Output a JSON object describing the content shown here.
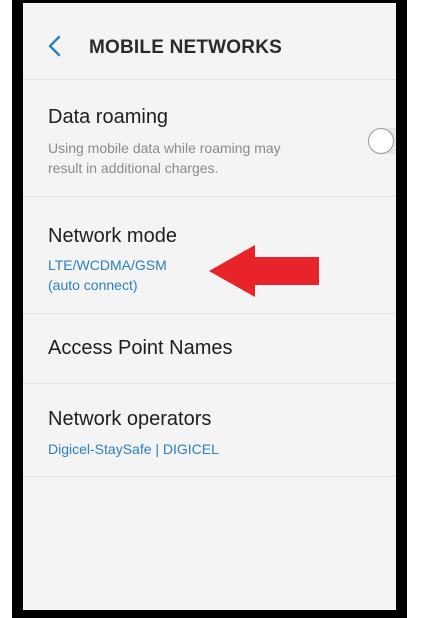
{
  "header": {
    "title": "MOBILE NETWORKS",
    "back_icon": "chevron-left-icon"
  },
  "data_roaming": {
    "title": "Data roaming",
    "description_line1": "Using mobile data while roaming may",
    "description_line2": "result in additional charges.",
    "toggle_on": false
  },
  "network_mode": {
    "title": "Network mode",
    "value_line1": "LTE/WCDMA/GSM",
    "value_line2": "(auto connect)"
  },
  "access_point_names": {
    "title": "Access Point Names"
  },
  "network_operators": {
    "title": "Network operators",
    "value": "Digicel-StaySafe | DIGICEL"
  },
  "annotation": {
    "arrow_icon": "red-arrow-left-icon",
    "arrow_color": "#e8232a"
  },
  "colors": {
    "accent": "#2a7fc2",
    "background": "#f4f4f4"
  }
}
